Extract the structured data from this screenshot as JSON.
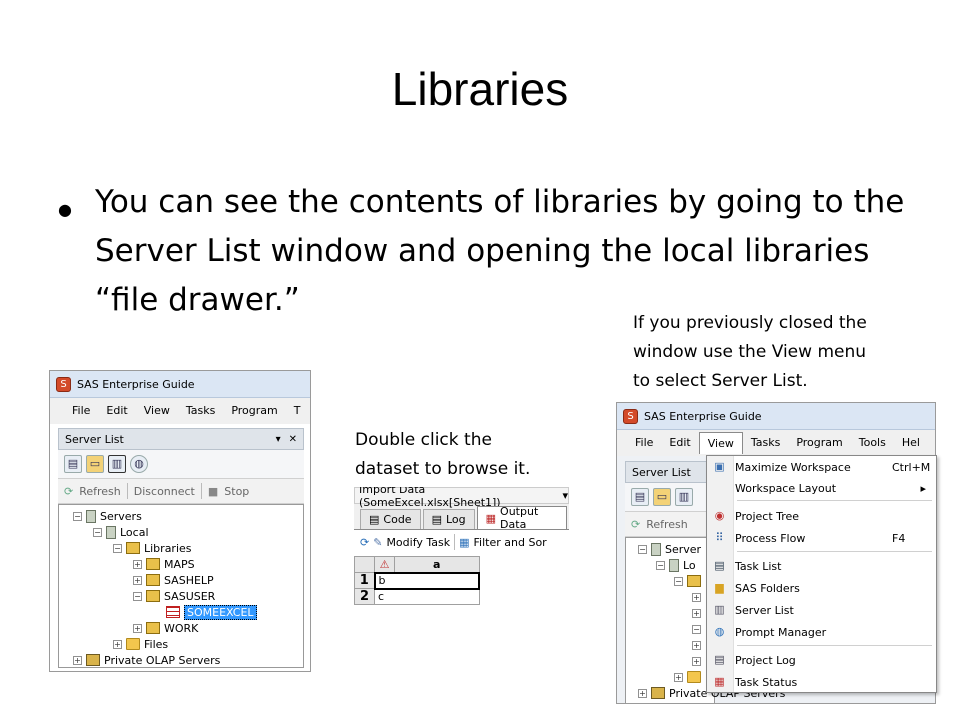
{
  "slide": {
    "title": "Libraries",
    "bullet_text": "You can see the contents of libraries by going to the Server List window and opening the local libraries “file drawer.”",
    "caption_right": [
      "If you previously closed the",
      "window use the View menu",
      "to select Server List."
    ],
    "caption_middle": [
      "Double click the",
      "dataset to browse it."
    ]
  },
  "left_window": {
    "title": "SAS Enterprise Guide",
    "menus": [
      "File",
      "Edit",
      "View",
      "Tasks",
      "Program",
      "T"
    ],
    "panel_title": "Server List",
    "actions": {
      "refresh": "Refresh",
      "disconnect": "Disconnect",
      "stop": "Stop"
    },
    "tree": [
      {
        "label": "Servers"
      },
      {
        "label": "Local"
      },
      {
        "label": "Libraries"
      },
      {
        "label": "MAPS"
      },
      {
        "label": "SASHELP"
      },
      {
        "label": "SASUSER"
      },
      {
        "label": "SOMEEXCEL"
      },
      {
        "label": "WORK"
      },
      {
        "label": "Files"
      },
      {
        "label": "Private OLAP Servers"
      }
    ]
  },
  "middle_window": {
    "import_label": "Import Data (SomeExcel.xlsx[Sheet1])",
    "tabs": [
      "Code",
      "Log",
      "Output Data"
    ],
    "toolbar": {
      "modify_task": "Modify Task",
      "filter_sort": "Filter and Sor"
    },
    "grid": {
      "column": "a",
      "rows": [
        {
          "num": "1",
          "value": "b"
        },
        {
          "num": "2",
          "value": "c"
        }
      ]
    }
  },
  "right_window": {
    "title": "SAS Enterprise Guide",
    "menus": [
      "File",
      "Edit",
      "View",
      "Tasks",
      "Program",
      "Tools",
      "Hel"
    ],
    "panel_title": "Server List",
    "refresh": "Refresh",
    "tree": [
      "Server",
      "Lo",
      "Private OLAP Servers"
    ],
    "view_menu": [
      {
        "label": "Maximize Workspace",
        "shortcut": "Ctrl+M"
      },
      {
        "label": "Workspace Layout",
        "shortcut": "▸"
      },
      {
        "label": "Project Tree",
        "shortcut": ""
      },
      {
        "label": "Process Flow",
        "shortcut": "F4"
      },
      {
        "label": "Task List",
        "shortcut": ""
      },
      {
        "label": "SAS Folders",
        "shortcut": ""
      },
      {
        "label": "Server List",
        "shortcut": ""
      },
      {
        "label": "Prompt Manager",
        "shortcut": ""
      },
      {
        "label": "Project Log",
        "shortcut": ""
      },
      {
        "label": "Task Status",
        "shortcut": ""
      }
    ]
  }
}
